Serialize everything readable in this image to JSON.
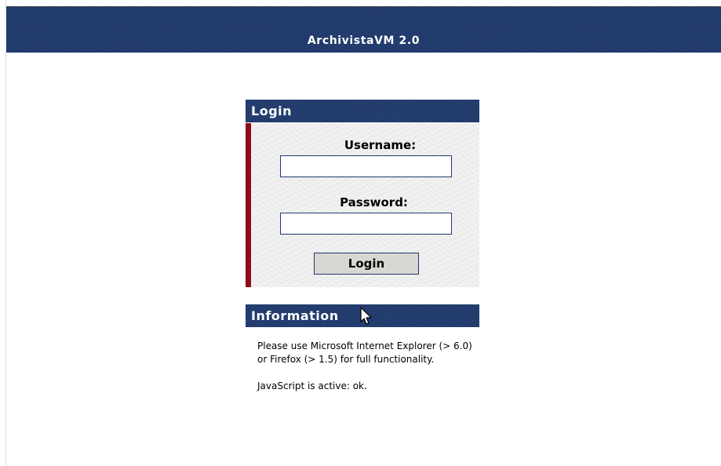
{
  "header": {
    "title": "ArchivistaVM 2.0"
  },
  "login": {
    "panel_title": "Login",
    "username_label": "Username:",
    "username_value": "",
    "password_label": "Password:",
    "password_value": "",
    "submit_label": "Login"
  },
  "information": {
    "panel_title": "Information",
    "browser_note": "Please use Microsoft Internet Explorer (> 6.0) or Firefox (> 1.5) for full functionality.",
    "javascript_status": "JavaScript is active: ok."
  },
  "icons": {
    "pointer": "mouse-pointer-icon"
  },
  "colors": {
    "header_blue": "#1f3a6e",
    "accent_red": "#8f0b1b",
    "form_background": "#eeeeee",
    "button_background": "#d9d7d4"
  }
}
